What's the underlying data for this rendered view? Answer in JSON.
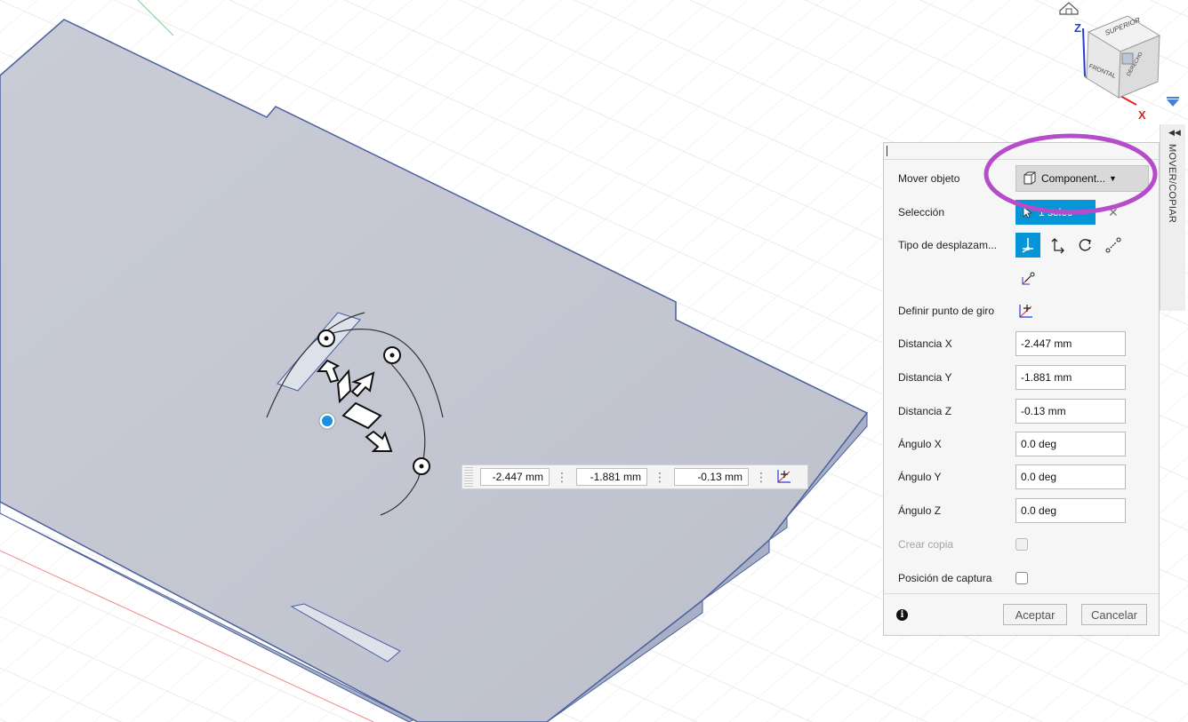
{
  "viewcube": {
    "top_label": "SUPERIOR",
    "front_label": "FRONTAL",
    "right_label": "DERECHO",
    "z_axis": "Z",
    "x_axis": "X",
    "home_icon": "home-icon"
  },
  "inline_bar": {
    "x_value": "-2.447 mm",
    "y_value": "-1.881 mm",
    "z_value": "-0.13 mm"
  },
  "panel": {
    "side_tab_label": "MOVER/COPIAR",
    "rows": {
      "move_object": {
        "label": "Mover objeto",
        "value": "Component..."
      },
      "selection": {
        "label": "Selección",
        "value": "1 selec"
      },
      "move_type": {
        "label": "Tipo de desplazam..."
      },
      "pivot": {
        "label": "Definir punto de giro"
      },
      "dist_x": {
        "label": "Distancia X",
        "value": "-2.447 mm"
      },
      "dist_y": {
        "label": "Distancia Y",
        "value": "-1.881 mm"
      },
      "dist_z": {
        "label": "Distancia Z",
        "value": "-0.13 mm"
      },
      "angle_x": {
        "label": "Ángulo X",
        "value": "0.0 deg"
      },
      "angle_y": {
        "label": "Ángulo Y",
        "value": "0.0 deg"
      },
      "angle_z": {
        "label": "Ángulo Z",
        "value": "0.0 deg"
      },
      "create_copy": {
        "label": "Crear copia"
      },
      "capture_position": {
        "label": "Posición de captura"
      }
    },
    "ok_label": "Aceptar",
    "cancel_label": "Cancelar"
  },
  "colors": {
    "accent": "#0696d7",
    "highlight": "#b54cc9",
    "part_fill": "#c5c9d5",
    "part_edge": "#4a5f9e",
    "axis_x": "#e2231a",
    "axis_z": "#2a3bd6"
  }
}
